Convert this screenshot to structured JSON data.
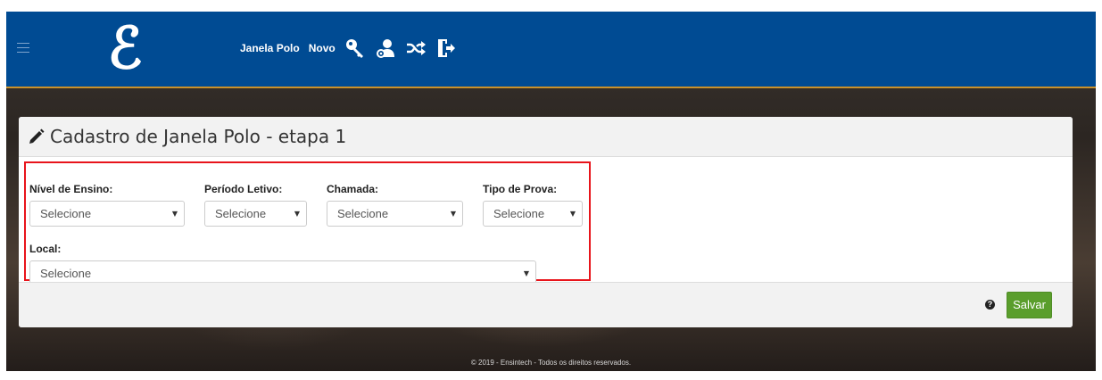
{
  "navbar": {
    "logo_char": "ℰ",
    "links": {
      "janela_polo": "Janela Polo",
      "novo": "Novo"
    },
    "icons": [
      "key-icon",
      "user-settings-icon",
      "shuffle-icon",
      "logout-icon"
    ],
    "background": "#004b93",
    "accent_border": "#c9912c"
  },
  "card": {
    "title": "Cadastro de Janela Polo - etapa 1",
    "title_icon": "pencil-icon"
  },
  "form": {
    "nivel_ensino": {
      "label": "Nível de Ensino:",
      "value": "Selecione"
    },
    "periodo_letivo": {
      "label": "Período Letivo:",
      "value": "Selecione"
    },
    "chamada": {
      "label": "Chamada:",
      "value": "Selecione"
    },
    "tipo_prova": {
      "label": "Tipo de Prova:",
      "value": "Selecione"
    },
    "local": {
      "label": "Local:",
      "value": "Selecione"
    },
    "highlight_color": "#e8141b"
  },
  "actions": {
    "help_glyph": "?",
    "save_label": "Salvar",
    "save_color": "#5a9e2c"
  },
  "footer": {
    "text": "© 2019 - Ensintech - Todos os direitos reservados."
  }
}
